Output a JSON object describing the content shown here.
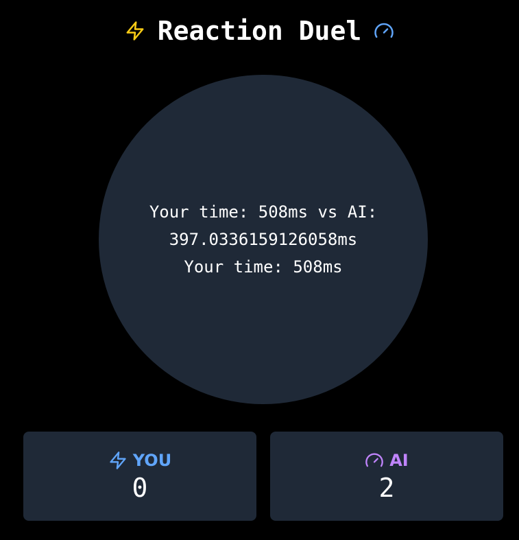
{
  "header": {
    "title": "Reaction Duel",
    "left_icon": "lightning-icon",
    "right_icon": "gauge-icon",
    "left_icon_color": "#facc15",
    "right_icon_color": "#60a5fa"
  },
  "reaction_circle": {
    "line1": "Your time: 508ms vs AI: 397.0336159126058ms",
    "line2": "Your time: 508ms",
    "background": "#1f2937"
  },
  "scores": {
    "you": {
      "label": "YOU",
      "value": "0",
      "icon": "lightning-icon",
      "color": "#60a5fa"
    },
    "ai": {
      "label": "AI",
      "value": "2",
      "icon": "gauge-icon",
      "color": "#c084fc"
    }
  }
}
